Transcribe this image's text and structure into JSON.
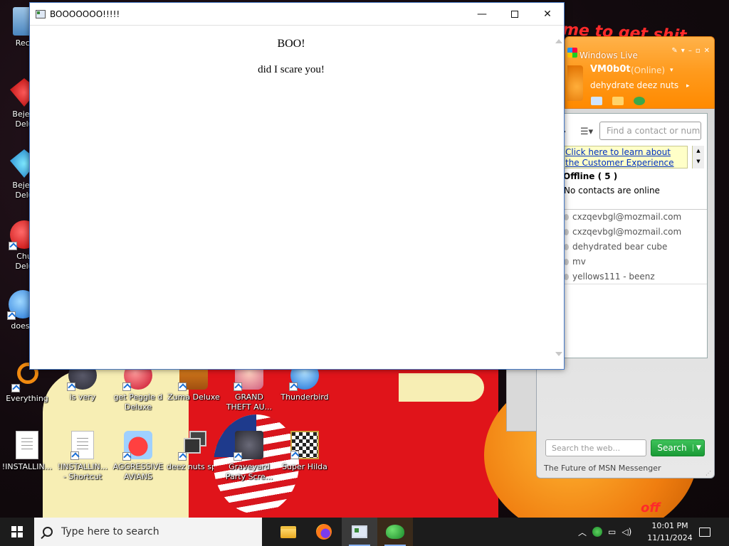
{
  "popup": {
    "title": "BOOOOOOO!!!!!",
    "heading": "BOO!",
    "message": "did I scare you!"
  },
  "desktop": {
    "left_icons": [
      {
        "label": "Recyc",
        "icon": "recycle-bin-icon"
      },
      {
        "label": "Bejew\nDelu",
        "icon": "red-gem-icon"
      },
      {
        "label": "Bejew\nDelu",
        "icon": "blue-gem-icon"
      },
      {
        "label": "Chu\nDelu",
        "icon": "red-ball-icon"
      },
      {
        "label": "doesn",
        "icon": "blue-bubble-icon"
      }
    ],
    "row1": [
      {
        "label": "Everything",
        "icon": "magnifier-icon"
      },
      {
        "label": "is very",
        "icon": "gear-icon"
      },
      {
        "label": "get Peggle d\nDeluxe",
        "icon": "peggle-icon"
      },
      {
        "label": "Zuma Deluxe",
        "icon": "zuma-icon"
      },
      {
        "label": "GRAND\nTHEFT AU...",
        "icon": "anime-girl-icon"
      },
      {
        "label": "Thunderbird",
        "icon": "thunderbird-icon"
      }
    ],
    "row2": [
      {
        "label": "!INSTALLIN...",
        "icon": "text-file-icon"
      },
      {
        "label": "!INSTALLIN...\n- Shortcut",
        "icon": "text-file-icon"
      },
      {
        "label": "AGGRESSIVE\nAVIANS",
        "icon": "angry-bird-icon"
      },
      {
        "label": "deez nuts spy",
        "icon": "windows-stack-icon"
      },
      {
        "label": "Graveyard\nParty Scre...",
        "icon": "graveyard-icon"
      },
      {
        "label": "Super Hilda",
        "icon": "pixel-character-icon"
      }
    ]
  },
  "messenger": {
    "brand": "Windows Live",
    "username": "VM0b0t",
    "status": "(Online)",
    "personal_message": "dehydrate deez nuts",
    "find_placeholder": "Find a contact or number",
    "banner": "Click here to learn about the Customer Experience",
    "group": "Offline ( 5 )",
    "no_contacts": "No contacts are online",
    "contacts": [
      "cxzqevbgl@mozmail.com",
      "cxzqevbgl@mozmail.com",
      "dehydrated bear cube",
      "mv",
      "yellows111 - beenz"
    ],
    "search_placeholder": "Search the web...",
    "search_button": "Search",
    "footer": "The Future of MSN Messenger"
  },
  "wallpaper_text": {
    "scrawl_top": "me to get shit",
    "scrawl_bottom": "off"
  },
  "taskbar": {
    "search_placeholder": "Type here to search",
    "time": "10:01 PM",
    "date": "11/11/2024",
    "apps": [
      "file-explorer-icon",
      "firefox-icon",
      "window-app-icon",
      "msn-messenger-icon"
    ]
  },
  "colors": {
    "msn_orange": "#ff9a1c",
    "search_green": "#1a9a36",
    "wallpaper_red": "#e0141a",
    "wallpaper_cream": "#f7eeb4",
    "taskbar": "#1c1c1c"
  }
}
